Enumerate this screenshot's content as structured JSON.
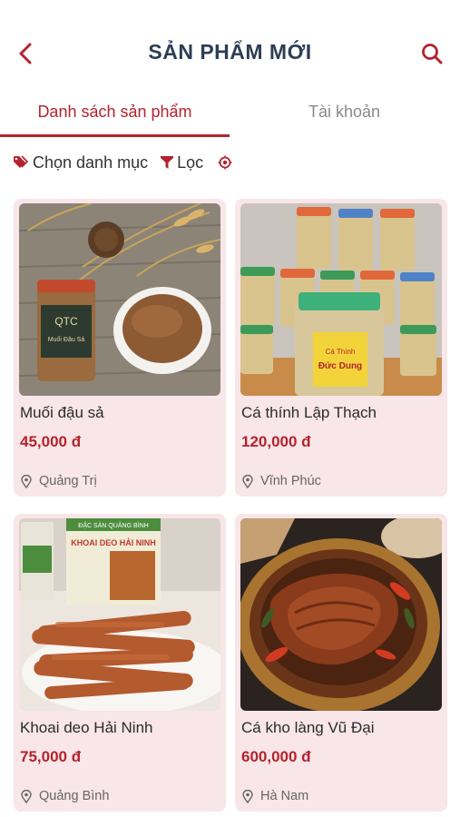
{
  "header": {
    "title": "SẢN PHẨM MỚI",
    "back_icon": "chevron-left-icon",
    "search_icon": "search-icon"
  },
  "tabs": [
    {
      "label": "Danh sách sản phẩm",
      "active": true
    },
    {
      "label": "Tài khoản",
      "active": false
    }
  ],
  "filters": {
    "category_label": "Chọn danh mục",
    "filter_label": "Lọc",
    "category_icon": "tag-icon",
    "filter_icon": "funnel-icon",
    "location_icon": "target-icon"
  },
  "products": [
    {
      "name": "Muối đậu sả",
      "price": "45,000 đ",
      "location": "Quảng Trị"
    },
    {
      "name": "Cá thính Lập Thạch",
      "price": "120,000 đ",
      "location": "Vĩnh Phúc"
    },
    {
      "name": "Khoai deo Hải Ninh",
      "price": "75,000 đ",
      "location": "Quảng Bình"
    },
    {
      "name": "Cá kho làng Vũ Đại",
      "price": "600,000 đ",
      "location": "Hà Nam"
    }
  ],
  "image_labels": {
    "qtc": "QTC",
    "muoi": "Muối Đậu Sả",
    "ca_thinh_1": "Cá Thính",
    "ca_thinh_2": "Đức Dung",
    "khoai_1": "ĐẶC SẢN QUẢNG BÌNH",
    "khoai_2": "KHOAI DEO HẢI NINH"
  },
  "colors": {
    "accent": "#b3232d",
    "title": "#2d3e55",
    "card_bg": "#f8e6e8"
  }
}
